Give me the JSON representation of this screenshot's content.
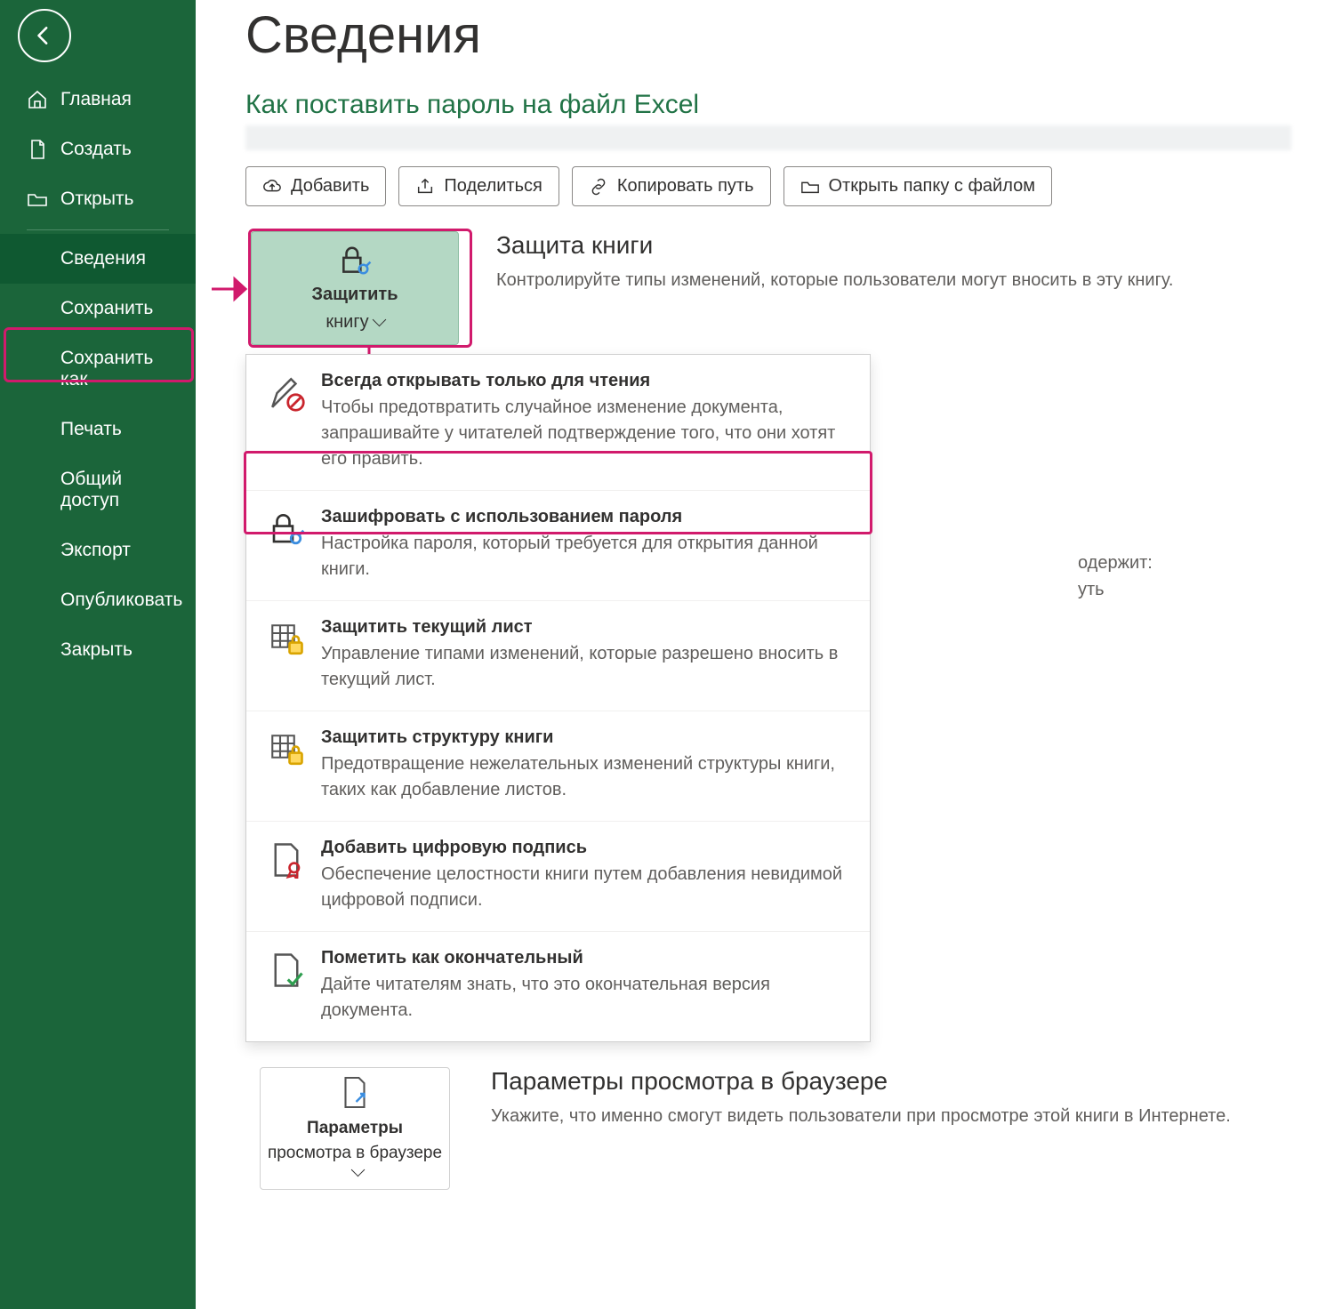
{
  "sidebar": {
    "items": [
      {
        "label": "Главная"
      },
      {
        "label": "Создать"
      },
      {
        "label": "Открыть"
      },
      {
        "label": "Сведения",
        "selected": true
      },
      {
        "label": "Сохранить"
      },
      {
        "label": "Сохранить как"
      },
      {
        "label": "Печать"
      },
      {
        "label": "Общий доступ"
      },
      {
        "label": "Экспорт"
      },
      {
        "label": "Опубликовать"
      },
      {
        "label": "Закрыть"
      }
    ]
  },
  "page": {
    "title": "Сведения",
    "subtitle_link": "Как поставить пароль на файл Excel"
  },
  "actions": {
    "upload": "Добавить",
    "share": "Поделиться",
    "copy_path": "Копировать путь",
    "open_folder": "Открыть папку с файлом"
  },
  "protect": {
    "button_top": "Защитить",
    "button_bottom": "книгу",
    "heading": "Защита книги",
    "desc": "Контролируйте типы изменений, которые пользователи могут вносить в эту книгу."
  },
  "menu": [
    {
      "title": "Всегда открывать только для чтения",
      "desc": "Чтобы предотвратить случайное изменение документа, запрашивайте у читателей подтверждение того, что они хотят его править."
    },
    {
      "title": "Зашифровать с использованием пароля",
      "desc": "Настройка пароля, который требуется для открытия данной книги."
    },
    {
      "title": "Защитить текущий лист",
      "desc": "Управление типами изменений, которые разрешено вносить в текущий лист."
    },
    {
      "title": "Защитить структуру книги",
      "desc": "Предотвращение нежелательных изменений структуры книги, таких как добавление листов."
    },
    {
      "title": "Добавить цифровую подпись",
      "desc": "Обеспечение целостности книги путем добавления невидимой цифровой подписи."
    },
    {
      "title": "Пометить как окончательный",
      "desc": "Дайте читателям знать, что это окончательная версия документа."
    }
  ],
  "float": {
    "l1": "одержит:",
    "l2": "уть"
  },
  "browser": {
    "button_top": "Параметры",
    "button_bottom": "просмотра в браузере",
    "heading": "Параметры просмотра в браузере",
    "desc": "Укажите, что именно смогут видеть пользователи при просмотре этой книги в Интернете."
  },
  "colors": {
    "accent": "#217346",
    "highlight": "#d11a6c"
  }
}
